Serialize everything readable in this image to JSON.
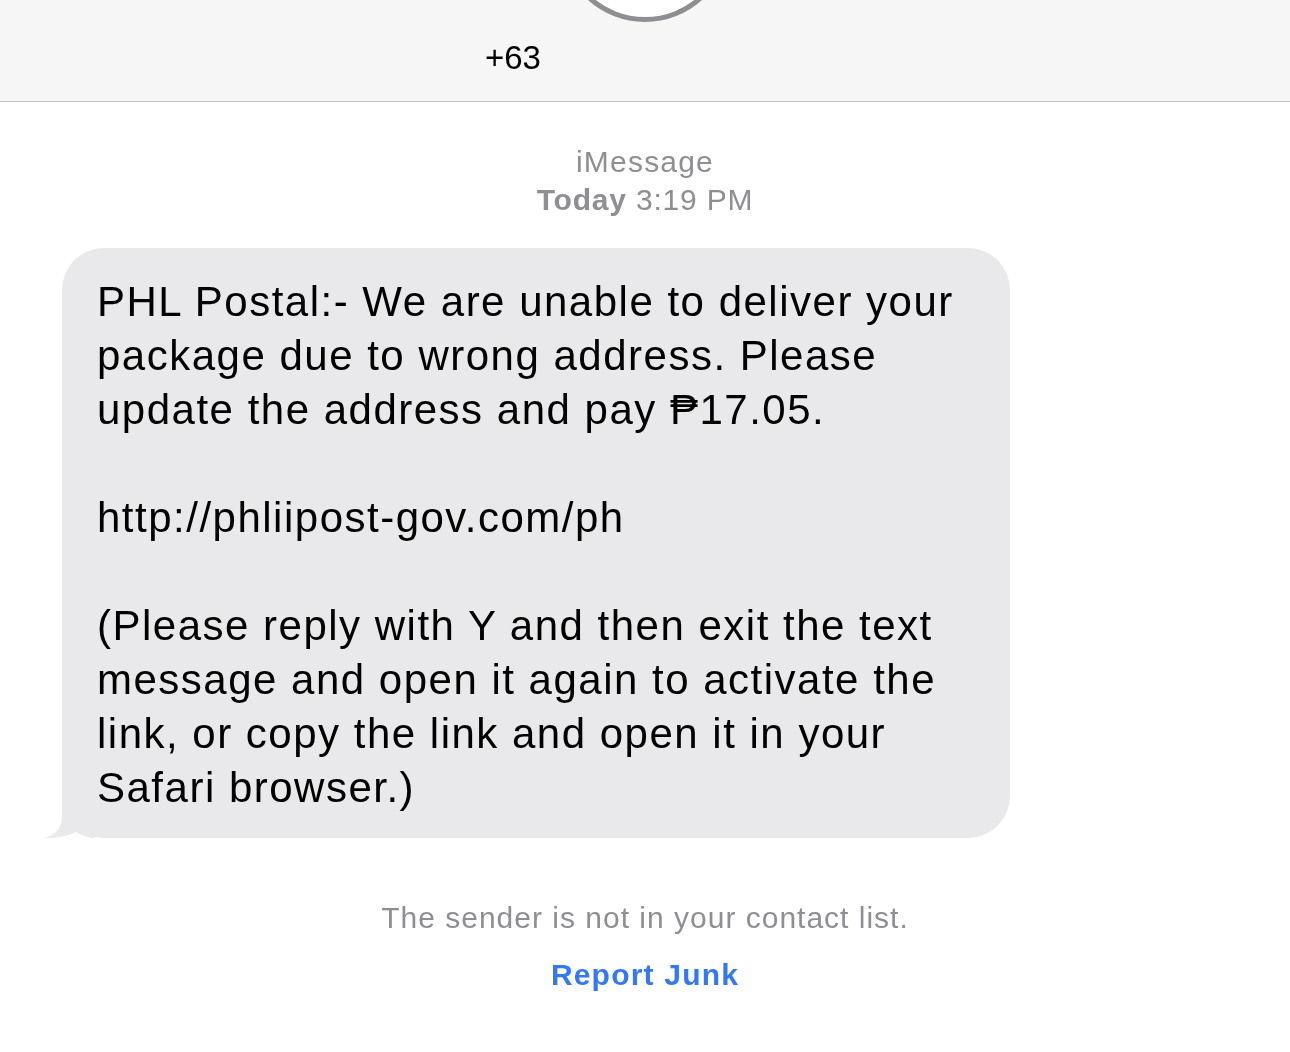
{
  "header": {
    "contact": "+63"
  },
  "thread": {
    "service": "iMessage",
    "timestamp": "**Today** 3:19 PM"
  },
  "messages": [
    {
      "outgoing": false,
      "paragraphs": [
        {
          "lines": [
            "PHL Postal:- We are unable to deliver your",
            "package due to wrong address. Please",
            "update the address and pay ₱17.05."
          ]
        },
        {
          "lines": [
            "http://phliipost-gov.com/ph"
          ]
        },
        {
          "lines": [
            "(Please reply with Y and then exit the text",
            "message and open it again to activate the",
            "link, or copy the link and open it in your",
            "Safari browser.)"
          ]
        }
      ]
    }
  ],
  "notice": {
    "text": "The sender is not in your contact list.",
    "action": "Report Junk"
  }
}
